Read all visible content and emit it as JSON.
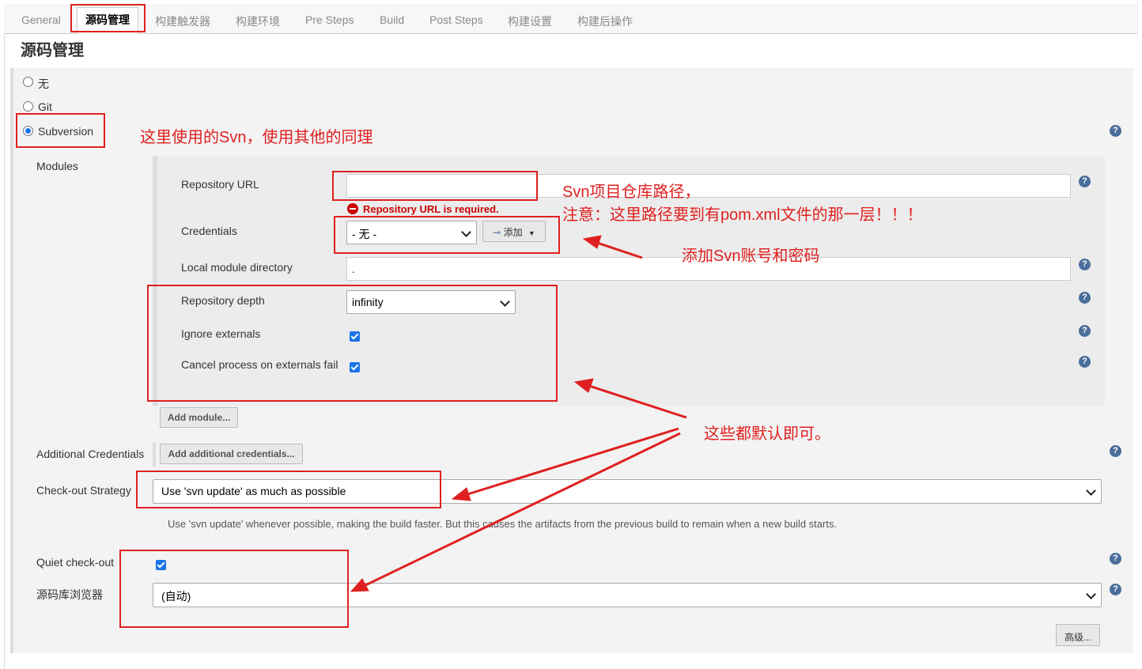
{
  "tabs": [
    "General",
    "源码管理",
    "构建触发器",
    "构建环境",
    "Pre Steps",
    "Build",
    "Post Steps",
    "构建设置",
    "构建后操作"
  ],
  "section_title": "源码管理",
  "scm_options": [
    "无",
    "Git",
    "Subversion"
  ],
  "modules": {
    "label": "Modules",
    "repo_url_label": "Repository URL",
    "repo_url_value": "",
    "repo_url_error": "Repository URL is required.",
    "credentials_label": "Credentials",
    "credentials_value": "- 无 -",
    "add_button": "添加",
    "local_dir_label": "Local module directory",
    "local_dir_value": ".",
    "depth_label": "Repository depth",
    "depth_value": "infinity",
    "ignore_externals_label": "Ignore externals",
    "cancel_externals_label": "Cancel process on externals fail",
    "add_module_button": "Add module..."
  },
  "additional_credentials": {
    "label": "Additional Credentials",
    "button": "Add additional credentials..."
  },
  "checkout": {
    "label": "Check-out Strategy",
    "value": "Use 'svn update' as much as possible",
    "description": "Use 'svn update' whenever possible, making the build faster. But this causes the artifacts from the previous build to remain when a new build starts."
  },
  "quiet_checkout_label": "Quiet check-out",
  "browser": {
    "label": "源码库浏览器",
    "value": "(自动)"
  },
  "advanced_button": "高级...",
  "annotations": {
    "svn_note": "这里使用的Svn，使用其他的同理",
    "repo_path_line1": "Svn项目仓库路径，",
    "repo_path_line2": "注意：这里路径要到有pom.xml文件的那一层！！！",
    "add_account": "添加Svn账号和密码",
    "defaults": "这些都默认即可。"
  },
  "colors": {
    "annotation_red": "#e02020",
    "help_blue": "#4a6d9a",
    "checkbox_blue": "#1a73e8"
  },
  "icons": [
    "help-icon",
    "key-icon",
    "chevron-down-icon",
    "error-icon"
  ]
}
